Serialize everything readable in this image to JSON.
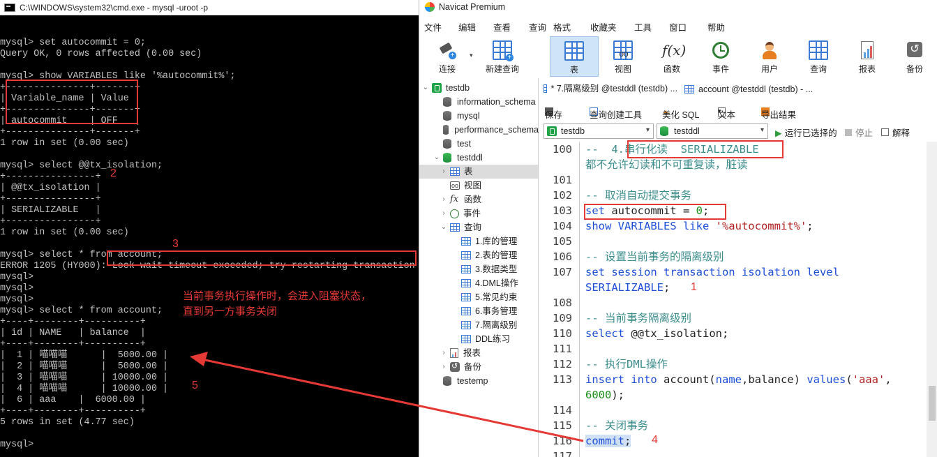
{
  "cmd": {
    "title": "C:\\WINDOWS\\system32\\cmd.exe - mysql  -uroot -p",
    "lines": [
      "",
      "mysql> set autocommit = 0;",
      "Query OK, 0 rows affected (0.00 sec)",
      "",
      "mysql> show VARIABLES like '%autocommit%';",
      "+---------------+-------+",
      "| Variable_name | Value |",
      "+---------------+-------+",
      "| autocommit    | OFF   |",
      "+---------------+-------+",
      "1 row in set (0.00 sec)",
      "",
      "mysql> select @@tx_isolation;",
      "+----------------+",
      "| @@tx_isolation |",
      "+----------------+",
      "| SERIALIZABLE   |",
      "+----------------+",
      "1 row in set (0.00 sec)",
      "",
      "mysql> select * from account;",
      "ERROR 1205 (HY000): Lock wait timeout exceeded; try restarting transaction",
      "mysql>",
      "mysql>",
      "mysql>",
      "mysql> select * from account;",
      "+----+--------+----------+",
      "| id | NAME   | balance  |",
      "+----+--------+----------+",
      "|  1 | 喵喵喵      |  5000.00 |",
      "|  2 | 喵喵喵      |  5000.00 |",
      "|  3 | 喵喵喵      | 10000.00 |",
      "|  4 | 喵喵喵      | 10000.00 |",
      "|  6 | aaa    |  6000.00 |",
      "+----+--------+----------+",
      "5 rows in set (4.77 sec)",
      "",
      "mysql>"
    ],
    "annotations": {
      "n2": "2",
      "n3": "3",
      "n5": "5",
      "note_line1": "当前事务执行操作时，会进入阻塞状态，",
      "note_line2": "直到另一方事务关闭"
    }
  },
  "navicat": {
    "title": "Navicat Premium",
    "menu": [
      "文件",
      "编辑",
      "查看",
      "查询",
      "格式",
      "收藏夹",
      "工具",
      "窗口",
      "帮助"
    ],
    "toolbar": [
      "连接",
      "新建查询",
      "表",
      "视图",
      "函数",
      "事件",
      "用户",
      "查询",
      "报表",
      "备份"
    ],
    "tree": {
      "connection": "testdb",
      "databases": [
        "information_schema",
        "mysql",
        "performance_schema",
        "test",
        "testddl"
      ],
      "testddl_children": [
        "表",
        "视图",
        "函数",
        "事件",
        "查询"
      ],
      "queries": [
        "1.库的管理",
        "2.表的管理",
        "3.数据类型",
        "4.DML操作",
        "5.常见约束",
        "6.事务管理",
        "7.隔离级别",
        "DDL练习"
      ],
      "after": [
        "报表",
        "备份"
      ],
      "last_db": "testemp"
    },
    "tabs": [
      "* 7.隔离级别 @testddl (testdb) ...",
      "account @testddl (testdb) - ..."
    ],
    "edit_toolbar": {
      "save": "保存",
      "builder": "查询创建工具",
      "beautify": "美化 SQL",
      "text": "文本",
      "export": "导出结果"
    },
    "selectors": {
      "connection": "testdb",
      "database": "testddl",
      "run": "运行已选择的",
      "stop": "停止",
      "explain": "解释"
    },
    "line_numbers": [
      "100",
      "",
      "101",
      "102",
      "103",
      "104",
      "105",
      "106",
      "107",
      "",
      "108",
      "109",
      "110",
      "111",
      "112",
      "113",
      "",
      "114",
      "115",
      "116",
      "117"
    ],
    "code": {
      "l100": "--  4.串行化读  SERIALIZABLE",
      "l100b": "都不允许幻读和不可重复读，脏读",
      "l102": "-- 取消自动提交事务",
      "l103a": "set",
      "l103b": " autocommit = ",
      "l103c": "0",
      "l103d": ";",
      "l104a": "show VARIABLES like ",
      "l104b": "'%autocommit%'",
      "l104c": ";",
      "l106": "-- 设置当前事务的隔离级别",
      "l107": "set session transaction isolation level",
      "l107b": "SERIALIZABLE",
      "l107c": ";",
      "l109": "-- 当前事务隔离级别",
      "l110a": "select",
      "l110b": " @@tx_isolation;",
      "l112": "-- 执行DML操作",
      "l113a": "insert into",
      "l113b": " account(",
      "l113c": "name",
      "l113d": ",balance) ",
      "l113e": "values",
      "l113f": "(",
      "l113g": "'aaa'",
      "l113h": ",",
      "l113i": "6000",
      "l113j": ");",
      "l115": "-- 关闭事务",
      "l116a": "commit",
      "l116b": ";"
    },
    "annotations": {
      "n1": "1",
      "n4": "4"
    }
  }
}
